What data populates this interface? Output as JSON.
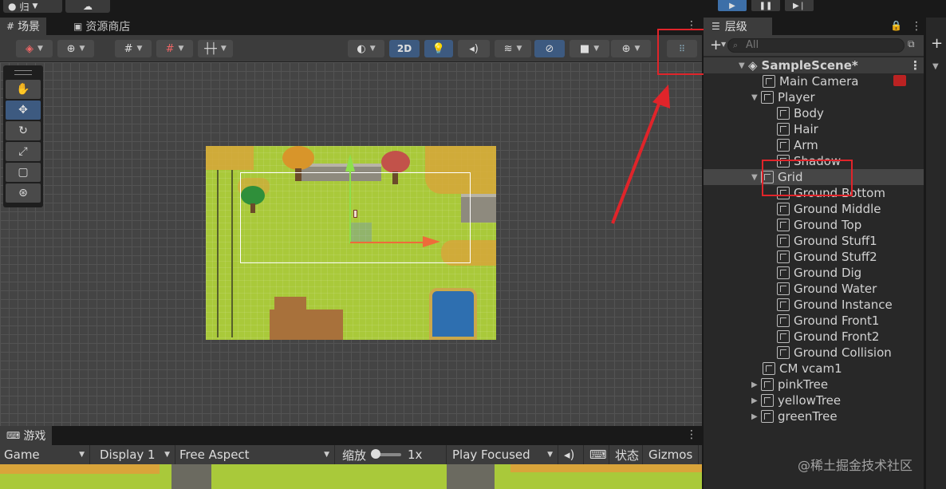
{
  "toolbar": {
    "account_label": "归",
    "cloud_icon": "cloud-icon",
    "play_icon": "play-icon",
    "pause_icon": "pause-icon",
    "step_icon": "step-icon"
  },
  "scene_panel": {
    "tabs": [
      {
        "label": "场景",
        "icon": "grid-icon"
      },
      {
        "label": "资源商店",
        "icon": "lock-icon"
      }
    ],
    "tools": {
      "mode_2d": "2D"
    },
    "tool_palette": [
      "hand-icon",
      "move-icon",
      "rotate-icon",
      "scale-icon",
      "rect-icon",
      "transform-icon"
    ]
  },
  "game_panel": {
    "tab_label": "游戏",
    "display_mode": "Game",
    "display": "Display 1",
    "aspect": "Free Aspect",
    "scale_label": "缩放",
    "scale_value": "1x",
    "play_mode": "Play Focused",
    "stats_label": "状态",
    "gizmos_label": "Gizmos"
  },
  "hierarchy": {
    "tab_label": "层级",
    "search_placeholder": "All",
    "scene_name": "SampleScene*",
    "items": [
      {
        "label": "Main Camera",
        "depth": 1,
        "expand": ""
      },
      {
        "label": "Player",
        "depth": 1,
        "expand": "▼"
      },
      {
        "label": "Body",
        "depth": 2,
        "expand": ""
      },
      {
        "label": "Hair",
        "depth": 2,
        "expand": ""
      },
      {
        "label": "Arm",
        "depth": 2,
        "expand": ""
      },
      {
        "label": "Shadow",
        "depth": 2,
        "expand": ""
      },
      {
        "label": "Grid",
        "depth": 1,
        "expand": "▼",
        "selected": true
      },
      {
        "label": "Ground Bottom",
        "depth": 2,
        "expand": ""
      },
      {
        "label": "Ground Middle",
        "depth": 2,
        "expand": ""
      },
      {
        "label": "Ground Top",
        "depth": 2,
        "expand": ""
      },
      {
        "label": "Ground Stuff1",
        "depth": 2,
        "expand": ""
      },
      {
        "label": "Ground Stuff2",
        "depth": 2,
        "expand": ""
      },
      {
        "label": "Ground Dig",
        "depth": 2,
        "expand": ""
      },
      {
        "label": "Ground Water",
        "depth": 2,
        "expand": ""
      },
      {
        "label": "Ground Instance",
        "depth": 2,
        "expand": ""
      },
      {
        "label": "Ground Front1",
        "depth": 2,
        "expand": ""
      },
      {
        "label": "Ground Front2",
        "depth": 2,
        "expand": ""
      },
      {
        "label": "Ground Collision",
        "depth": 2,
        "expand": ""
      },
      {
        "label": "CM vcam1",
        "depth": 1,
        "expand": ""
      },
      {
        "label": "pinkTree",
        "depth": 1,
        "expand": "▶"
      },
      {
        "label": "yellowTree",
        "depth": 1,
        "expand": "▶"
      },
      {
        "label": "greenTree",
        "depth": 1,
        "expand": "▶"
      }
    ]
  },
  "watermark": "@稀土掘金技术社区",
  "colors": {
    "annotation_red": "#e0242a",
    "selection_blue": "#3d5a80",
    "grass": "#a9c93a"
  }
}
